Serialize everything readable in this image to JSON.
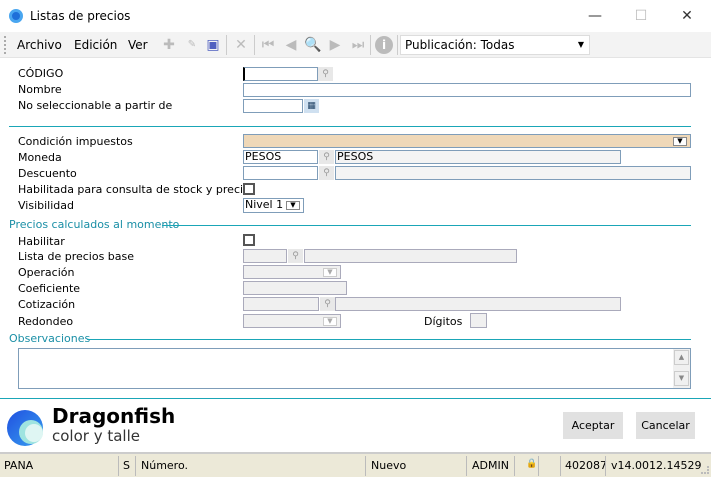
{
  "window": {
    "title": "Listas de precios",
    "minimize": "—",
    "maximize": "☐",
    "close": "✕"
  },
  "menu": {
    "archivo": "Archivo",
    "edicion": "Edición",
    "ver": "Ver"
  },
  "toolbar": {
    "publication": "Publicación: Todas"
  },
  "form": {
    "codigo": {
      "label": "CÓDIGO",
      "value": ""
    },
    "nombre": {
      "label": "Nombre",
      "value": ""
    },
    "no_seleccionable": {
      "label": "No seleccionable a partir de",
      "value": ""
    },
    "condicion": {
      "label": "Condición impuestos",
      "value": ""
    },
    "moneda": {
      "label": "Moneda",
      "value": "PESOS",
      "description": "PESOS"
    },
    "descuento": {
      "label": "Descuento",
      "value": "",
      "description": ""
    },
    "habilitada": {
      "label": "Habilitada para consulta de stock y precios",
      "checked": false
    },
    "visibilidad": {
      "label": "Visibilidad",
      "value": "Nivel 1"
    }
  },
  "calc": {
    "section": "Precios calculados al momento",
    "habilitar": {
      "label": "Habilitar",
      "checked": false
    },
    "lista_base": {
      "label": "Lista de precios base"
    },
    "operacion": {
      "label": "Operación"
    },
    "coeficiente": {
      "label": "Coeficiente"
    },
    "cotizacion": {
      "label": "Cotización"
    },
    "redondeo": {
      "label": "Redondeo"
    },
    "digitos": {
      "label": "Dígitos"
    }
  },
  "observaciones": {
    "section": "Observaciones",
    "value": ""
  },
  "logo": {
    "name": "Dragonfish",
    "tagline": "color y talle"
  },
  "buttons": {
    "accept": "Aceptar",
    "cancel": "Cancelar"
  },
  "status": {
    "company": "PANA",
    "s": "S",
    "numero": "Número.",
    "state": "Nuevo",
    "user": "ADMIN",
    "code": "402087",
    "version": "v14.0012.14529"
  },
  "colors": {
    "accent": "#1aa6b7",
    "required": "#efd8b8",
    "statusbar": "#ece9d8"
  }
}
